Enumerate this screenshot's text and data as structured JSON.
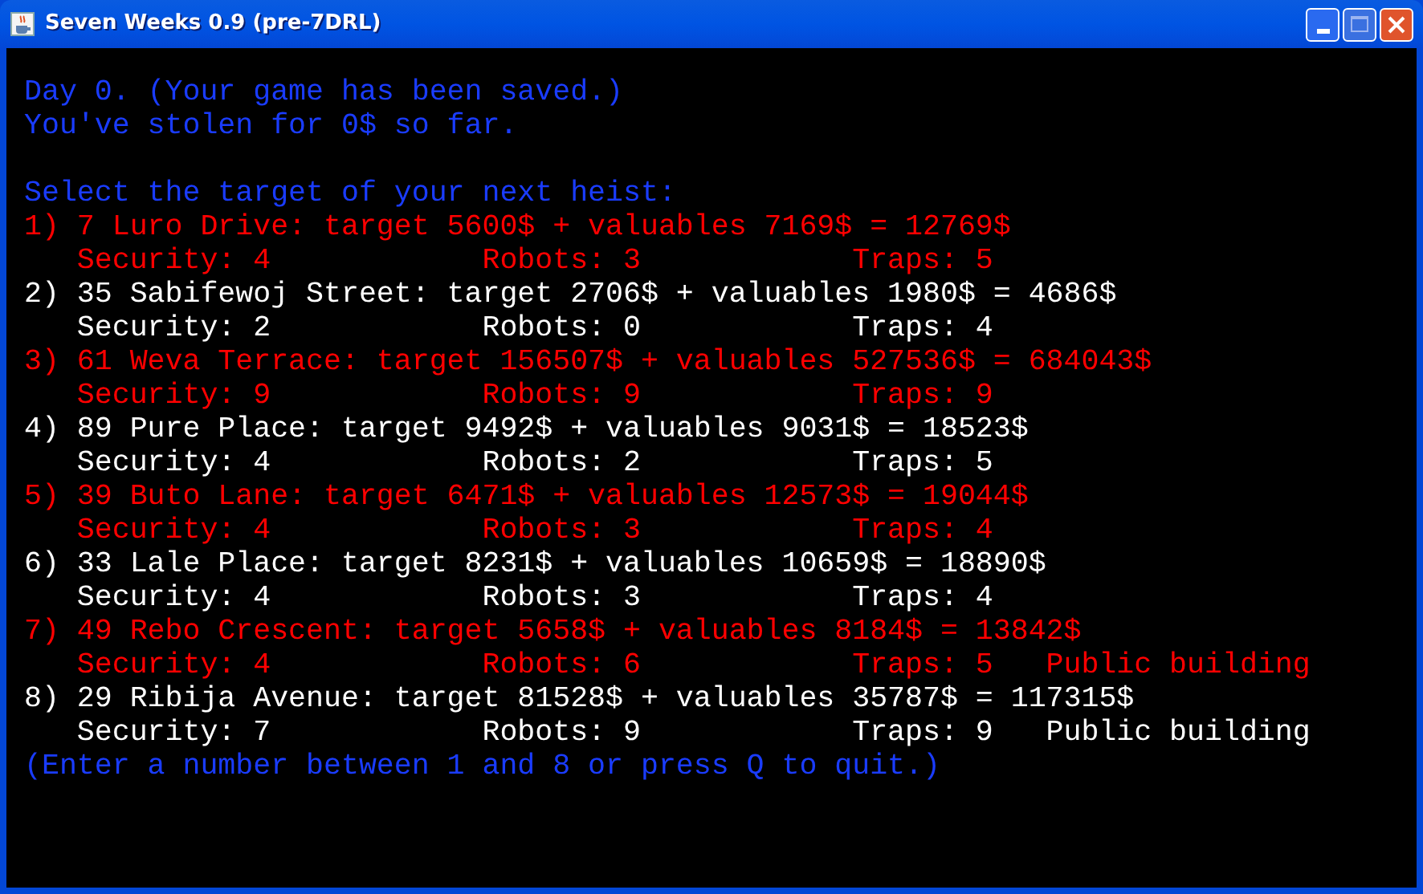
{
  "window": {
    "title": "Seven Weeks 0.9 (pre-7DRL)"
  },
  "status_lines": [
    "Day 0. (Your game has been saved.)",
    "You've stolen for 0$ so far."
  ],
  "prompt": "Select the target of your next heist:",
  "targets": [
    {
      "heading": "1) 7 Luro Drive: target 5600$ + valuables 7169$ = 12769$",
      "security": "Security: 4",
      "robots": "Robots: 3",
      "traps": "Traps: 5",
      "color": "#ff0000"
    },
    {
      "heading": "2) 35 Sabifewoj Street: target 2706$ + valuables 1980$ = 4686$",
      "security": "Security: 2",
      "robots": "Robots: 0",
      "traps": "Traps: 4",
      "color": "#ffffff"
    },
    {
      "heading": "3) 61 Weva Terrace: target 156507$ + valuables 527536$ = 684043$",
      "security": "Security: 9",
      "robots": "Robots: 9",
      "traps": "Traps: 9",
      "color": "#ff0000"
    },
    {
      "heading": "4) 89 Pure Place: target 9492$ + valuables 9031$ = 18523$",
      "security": "Security: 4",
      "robots": "Robots: 2",
      "traps": "Traps: 5",
      "color": "#ffffff"
    },
    {
      "heading": "5) 39 Buto Lane: target 6471$ + valuables 12573$ = 19044$",
      "security": "Security: 4",
      "robots": "Robots: 3",
      "traps": "Traps: 4",
      "color": "#ff0000"
    },
    {
      "heading": "6) 33 Lale Place: target 8231$ + valuables 10659$ = 18890$",
      "security": "Security: 4",
      "robots": "Robots: 3",
      "traps": "Traps: 4",
      "color": "#ffffff"
    },
    {
      "heading": "7) 49 Rebo Crescent: target 5658$ + valuables 8184$ = 13842$",
      "security": "Security: 4",
      "robots": "Robots: 6",
      "traps": "Traps: 5",
      "note": "Public building",
      "color": "#ff0000"
    },
    {
      "heading": "8) 29 Ribija Avenue: target 81528$ + valuables 35787$ = 117315$",
      "security": "Security: 7",
      "robots": "Robots: 9",
      "traps": "Traps: 9",
      "note": "Public building",
      "color": "#ffffff"
    }
  ],
  "footer": "(Enter a number between 1 and 8 or press Q to quit.)"
}
